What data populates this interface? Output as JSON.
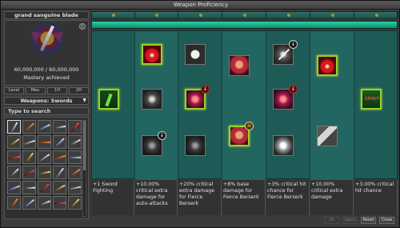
{
  "window": {
    "title": "Weapon Proficiency"
  },
  "item": {
    "name": "grand sanguine blade",
    "progress": "60,000,000 / 60,000,000",
    "status": "Mastery achieved",
    "info_glyph": "i"
  },
  "levels": [
    "Level",
    "Mas.",
    "1H",
    "2H"
  ],
  "category": {
    "label": "Weapons: Swords",
    "arrow": "▼"
  },
  "search": {
    "placeholder": "Type to search"
  },
  "weapon_grid": {
    "count": 30
  },
  "progress_bar": {
    "segments": 7,
    "fill": 1.0
  },
  "nodes": [
    {
      "id": "n1",
      "kind": "green",
      "label": "Sword Fighting",
      "active": true
    },
    {
      "id": "n2",
      "kind": "red",
      "active": true
    },
    {
      "id": "n3",
      "kind": "sword"
    },
    {
      "id": "n4",
      "kind": "dark"
    },
    {
      "id": "n5",
      "kind": "skull"
    },
    {
      "id": "n6",
      "kind": "crit",
      "active": true
    },
    {
      "id": "n7",
      "kind": "dark"
    },
    {
      "id": "n8",
      "kind": "bers"
    },
    {
      "id": "n9",
      "kind": "bers",
      "active": true
    },
    {
      "id": "n10",
      "kind": "slash"
    },
    {
      "id": "n11",
      "kind": "crit"
    },
    {
      "id": "n12",
      "kind": "sparkle"
    },
    {
      "id": "n13",
      "kind": "red",
      "active": true
    },
    {
      "id": "n14",
      "kind": "book"
    },
    {
      "id": "n15",
      "kind": "spirit",
      "text": "SPIRIT",
      "active": true
    }
  ],
  "badges": {
    "down": "↓",
    "skull": "☠"
  },
  "descriptions": [
    "+1 Sword Fighting",
    "+10.00% critical extra damage for auto-attacks",
    "+20% critical extra damage for Fierce Berserk",
    "+8% base damage for Fierce Berserk",
    "+3% critical hit chance for Fierce Berserk",
    "+10.00% critical extra damage",
    "+3.00% critical hit chance"
  ],
  "buttons": {
    "ok": "Ok",
    "apply": "Apply",
    "reset": "Reset",
    "close": "Close"
  },
  "colors": {
    "tree_bg": "#1f5b56",
    "active_border": "#9cd12a",
    "progress_fill": "#26cfa8"
  }
}
